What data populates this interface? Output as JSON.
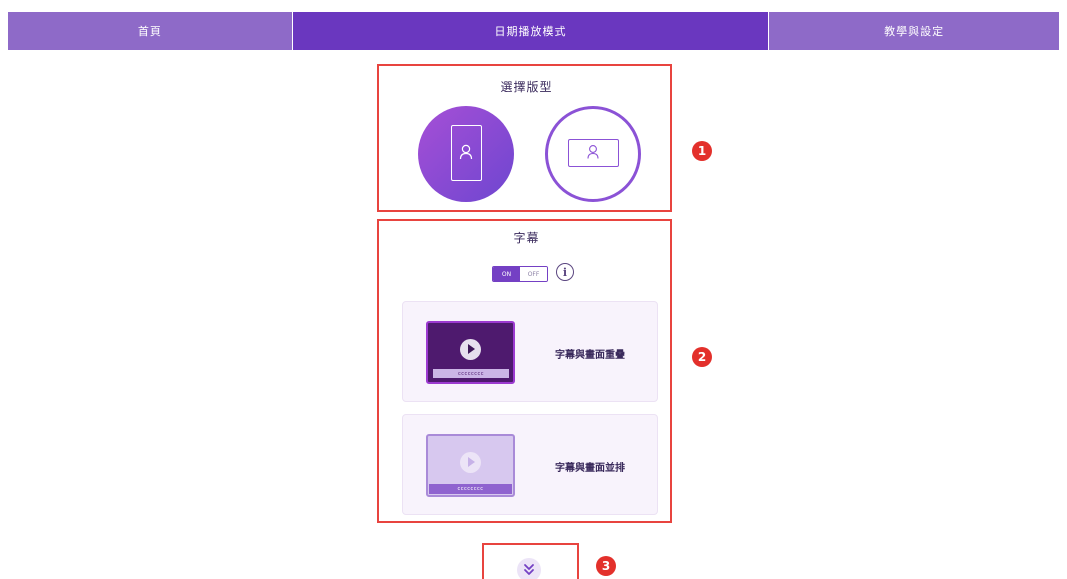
{
  "nav": {
    "tabs": [
      {
        "label": "首頁",
        "active": false
      },
      {
        "label": "日期播放模式",
        "active": true
      },
      {
        "label": "教學與設定",
        "active": false
      }
    ]
  },
  "layout_section": {
    "title": "選擇版型",
    "options": [
      {
        "icon": "portrait-layout-icon",
        "selected": true
      },
      {
        "icon": "landscape-layout-icon",
        "selected": false
      }
    ]
  },
  "subtitle_section": {
    "title": "字幕",
    "toggle": {
      "on_label": "ON",
      "off_label": "OFF",
      "state": "ON"
    },
    "info_glyph": "i",
    "options": [
      {
        "label": "字幕與畫面重疊",
        "caption": "cccccccc",
        "selected": true
      },
      {
        "label": "字幕與畫面並排",
        "caption": "cccccccc",
        "selected": false
      }
    ]
  },
  "badges": [
    "1",
    "2",
    "3"
  ],
  "colors": {
    "nav_active": "#6a37bf",
    "nav_inactive": "#8e6ac8",
    "accent": "#8b52d6",
    "highlight_box": "#e8443f",
    "badge": "#e3302b"
  }
}
